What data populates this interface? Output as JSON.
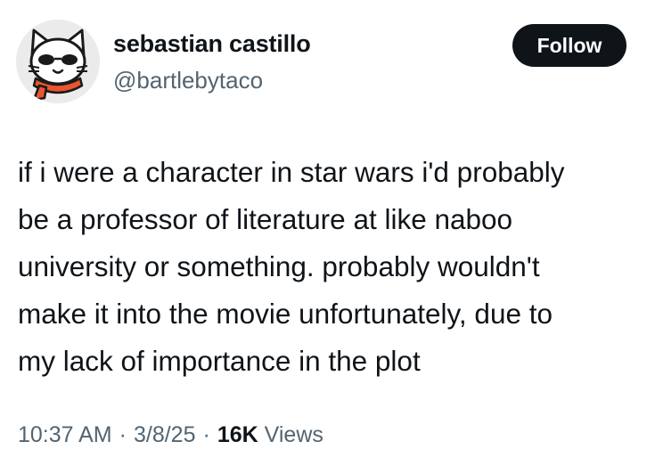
{
  "author": {
    "display_name": "sebastian castillo",
    "handle": "@bartlebytaco",
    "avatar_icon": "cat-with-sunglasses-and-scarf-icon"
  },
  "follow_button": {
    "label": "Follow"
  },
  "tweet": {
    "lines": [
      "if i were a character in star wars i'd probably",
      "be a professor of literature at like naboo",
      "university or something. probably wouldn't",
      "make it into the movie unfortunately, due to",
      "my lack of importance in the plot"
    ]
  },
  "meta": {
    "time": "10:37 AM",
    "separator": "·",
    "date": "3/8/25",
    "views_count": "16K",
    "views_label": "Views"
  },
  "colors": {
    "text_primary": "#0f1419",
    "text_secondary": "#536471",
    "follow_bg": "#0f1419",
    "follow_text": "#ffffff",
    "scarf": "#e8552f"
  }
}
